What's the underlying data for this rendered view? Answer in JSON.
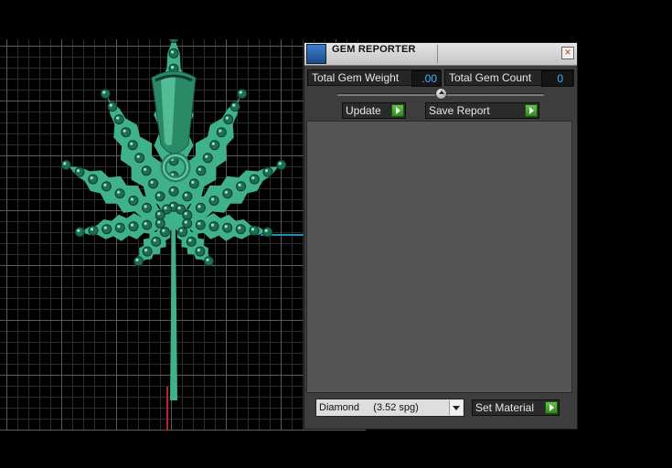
{
  "panel": {
    "title": "GEM REPORTER",
    "close_glyph": "×",
    "total_gem_weight_label": "Total Gem Weight",
    "total_gem_weight_value": ".00",
    "total_gem_count_label": "Total Gem Count",
    "total_gem_count_value": "0",
    "update_label": "Update",
    "save_report_label": "Save Report",
    "material_value": "Diamond     (3.52 spg)",
    "set_material_label": "Set Material",
    "icons": [
      "app-icon",
      "close-icon",
      "slider-thumb",
      "play-icon",
      "dropdown-arrow-icon"
    ]
  },
  "viewport": {
    "model": "cannabis-leaf-pendant-with-bail",
    "model_color": "#3fb28a",
    "grid_color": "#5a5a5a"
  }
}
